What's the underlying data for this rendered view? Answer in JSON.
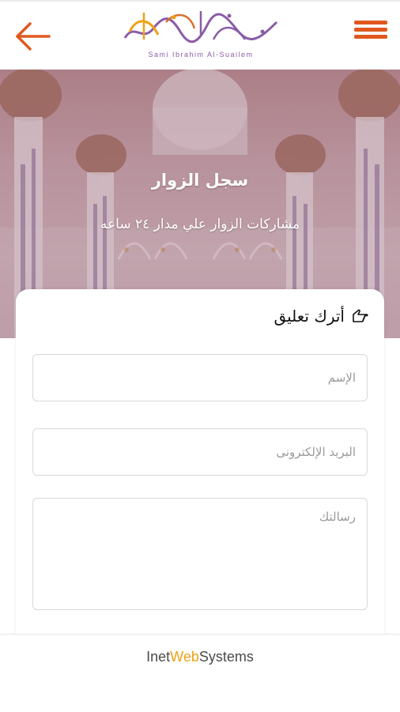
{
  "header": {
    "logo_latin": "Sami Ibrahim Al-Suailem",
    "colors": {
      "accent": "#e0581f",
      "logo_purple": "#8a5ca8",
      "logo_orange": "#f0a012"
    }
  },
  "hero": {
    "title": "سجل الزوار",
    "subtitle": "مشاركات الزوار علي مدار ٢٤ ساعه"
  },
  "form": {
    "heading": "أترك تعليق",
    "name_placeholder": "الإسم",
    "email_placeholder": "البريد الإلكترونى",
    "message_placeholder": "رسالتك"
  },
  "footer": {
    "brand_part1": "Inet",
    "brand_part2": "Web",
    "brand_part3": "Systems"
  }
}
